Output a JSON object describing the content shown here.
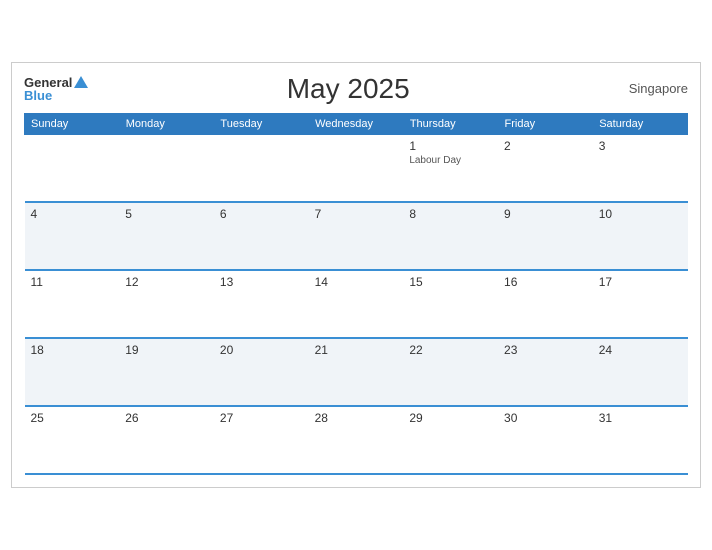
{
  "header": {
    "title": "May 2025",
    "region": "Singapore",
    "logo_general": "General",
    "logo_blue": "Blue"
  },
  "weekdays": [
    "Sunday",
    "Monday",
    "Tuesday",
    "Wednesday",
    "Thursday",
    "Friday",
    "Saturday"
  ],
  "weeks": [
    [
      {
        "day": "",
        "event": ""
      },
      {
        "day": "",
        "event": ""
      },
      {
        "day": "",
        "event": ""
      },
      {
        "day": "",
        "event": ""
      },
      {
        "day": "1",
        "event": "Labour Day"
      },
      {
        "day": "2",
        "event": ""
      },
      {
        "day": "3",
        "event": ""
      }
    ],
    [
      {
        "day": "4",
        "event": ""
      },
      {
        "day": "5",
        "event": ""
      },
      {
        "day": "6",
        "event": ""
      },
      {
        "day": "7",
        "event": ""
      },
      {
        "day": "8",
        "event": ""
      },
      {
        "day": "9",
        "event": ""
      },
      {
        "day": "10",
        "event": ""
      }
    ],
    [
      {
        "day": "11",
        "event": ""
      },
      {
        "day": "12",
        "event": ""
      },
      {
        "day": "13",
        "event": ""
      },
      {
        "day": "14",
        "event": ""
      },
      {
        "day": "15",
        "event": ""
      },
      {
        "day": "16",
        "event": ""
      },
      {
        "day": "17",
        "event": ""
      }
    ],
    [
      {
        "day": "18",
        "event": ""
      },
      {
        "day": "19",
        "event": ""
      },
      {
        "day": "20",
        "event": ""
      },
      {
        "day": "21",
        "event": ""
      },
      {
        "day": "22",
        "event": ""
      },
      {
        "day": "23",
        "event": ""
      },
      {
        "day": "24",
        "event": ""
      }
    ],
    [
      {
        "day": "25",
        "event": ""
      },
      {
        "day": "26",
        "event": ""
      },
      {
        "day": "27",
        "event": ""
      },
      {
        "day": "28",
        "event": ""
      },
      {
        "day": "29",
        "event": ""
      },
      {
        "day": "30",
        "event": ""
      },
      {
        "day": "31",
        "event": ""
      }
    ]
  ]
}
